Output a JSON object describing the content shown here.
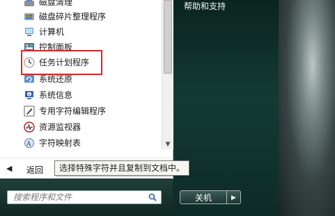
{
  "menu": {
    "items": [
      {
        "label": "磁盘清理",
        "icon": "disk-cleanup-icon"
      },
      {
        "label": "磁盘碎片整理程序",
        "icon": "defragmenter-icon"
      },
      {
        "label": "计算机",
        "icon": "computer-icon"
      },
      {
        "label": "控制面板",
        "icon": "control-panel-icon"
      },
      {
        "label": "任务计划程序",
        "icon": "clock-icon"
      },
      {
        "label": "系统还原",
        "icon": "system-restore-icon"
      },
      {
        "label": "系统信息",
        "icon": "system-info-icon"
      },
      {
        "label": "专用字符编辑程序",
        "icon": "char-editor-icon"
      },
      {
        "label": "资源监视器",
        "icon": "resource-monitor-icon"
      },
      {
        "label": "字符映射表",
        "icon": "char-map-icon"
      }
    ],
    "back_label": "返回",
    "tooltip": "选择特殊字符并且复制到文档中。"
  },
  "right": {
    "help_label": "帮助和支持"
  },
  "search": {
    "placeholder": "搜索程序和文件"
  },
  "shutdown": {
    "label": "关机"
  },
  "colors": {
    "highlight_border": "#d6262a",
    "aero_dark": "#143a34"
  }
}
